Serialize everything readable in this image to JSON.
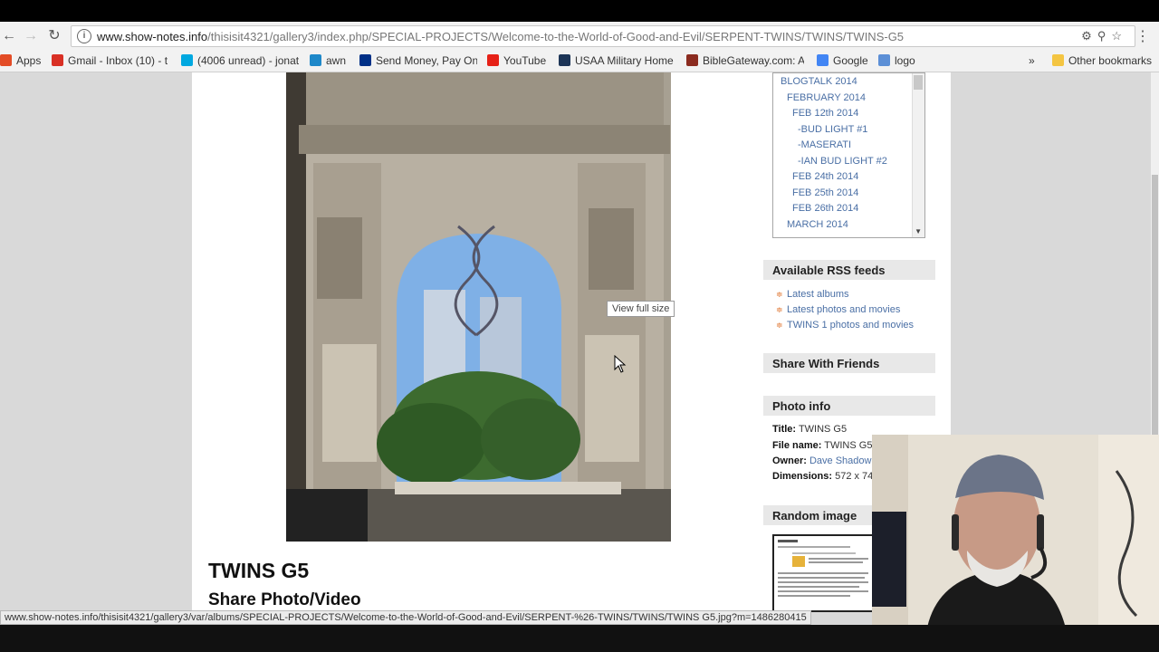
{
  "browser": {
    "url_host": "www.show-notes.info",
    "url_path": "/thisisit4321/gallery3/index.php/SPECIAL-PROJECTS/Welcome-to-the-World-of-Good-and-Evil/SERPENT-TWINS/TWINS/TWINS-G5"
  },
  "bookmarks": [
    {
      "label": "Apps",
      "icon": "apps-grid-icon",
      "color": "#e34c26"
    },
    {
      "label": "Gmail - Inbox (10) - t",
      "icon": "gmail-icon",
      "color": "#d93025"
    },
    {
      "label": "(4006 unread) - jonat",
      "icon": "att-icon",
      "color": "#00a8e0"
    },
    {
      "label": "awn",
      "icon": "awn-icon",
      "color": "#1e88c9"
    },
    {
      "label": "Send Money, Pay Onl",
      "icon": "paypal-icon",
      "color": "#003087"
    },
    {
      "label": "YouTube",
      "icon": "youtube-icon",
      "color": "#e62117"
    },
    {
      "label": "USAA Military Home",
      "icon": "usaa-icon",
      "color": "#1d3557"
    },
    {
      "label": "BibleGateway.com: A",
      "icon": "biblegateway-icon",
      "color": "#8b2b1f"
    },
    {
      "label": "Google",
      "icon": "google-icon",
      "color": "#4285f4"
    },
    {
      "label": "logo",
      "icon": "logo-icon",
      "color": "#5c8fd6"
    }
  ],
  "bookmarks_more": "»",
  "other_bookmarks": "Other bookmarks",
  "tree": [
    {
      "label": "BLOGTALK 2014",
      "indent": 0
    },
    {
      "label": "FEBRUARY 2014",
      "indent": 1
    },
    {
      "label": "FEB 12th 2014",
      "indent": 2
    },
    {
      "label": "-BUD LIGHT #1",
      "indent": 3
    },
    {
      "label": "-MASERATI",
      "indent": 3
    },
    {
      "label": "-IAN BUD LIGHT #2",
      "indent": 3
    },
    {
      "label": "FEB 24th 2014",
      "indent": 2
    },
    {
      "label": "FEB 25th 2014",
      "indent": 2
    },
    {
      "label": "FEB 26th 2014",
      "indent": 2
    },
    {
      "label": "MARCH 2014",
      "indent": 1
    }
  ],
  "rss": {
    "heading": "Available RSS feeds",
    "items": [
      "Latest albums",
      "Latest photos and movies",
      "TWINS 1 photos and movies"
    ]
  },
  "share_friends": "Share With Friends",
  "photo_info": {
    "heading": "Photo info",
    "title_label": "Title:",
    "title_value": "TWINS G5",
    "file_label": "File name:",
    "file_value": "TWINS G5.j",
    "owner_label": "Owner:",
    "owner_value": "Dave Shadow",
    "dim_label": "Dimensions:",
    "dim_value": "572 x 74"
  },
  "random_image": "Random image",
  "photo": {
    "tooltip": "View full size",
    "title": "TWINS G5",
    "share_heading": "Share Photo/Video"
  },
  "status_url": "www.show-notes.info/thisisit4321/gallery3/var/albums/SPECIAL-PROJECTS/Welcome-to-the-World-of-Good-and-Evil/SERPENT-%26-TWINS/TWINS/TWINS G5.jpg?m=1486280415"
}
